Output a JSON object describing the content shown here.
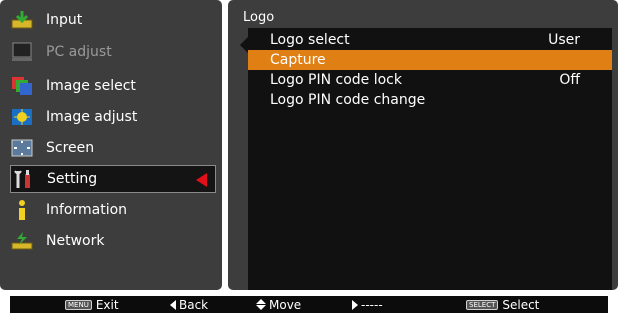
{
  "left_menu": {
    "items": [
      {
        "label": "Input",
        "icon": "input-icon",
        "state": "normal"
      },
      {
        "label": "PC adjust",
        "icon": "pc-adjust-icon",
        "state": "dim"
      },
      {
        "label": "Image select",
        "icon": "image-select-icon",
        "state": "normal"
      },
      {
        "label": "Image adjust",
        "icon": "image-adjust-icon",
        "state": "normal"
      },
      {
        "label": "Screen",
        "icon": "screen-icon",
        "state": "normal"
      },
      {
        "label": "Setting",
        "icon": "setting-icon",
        "state": "selected"
      },
      {
        "label": "Information",
        "icon": "information-icon",
        "state": "normal"
      },
      {
        "label": "Network",
        "icon": "network-icon",
        "state": "normal"
      }
    ]
  },
  "right_panel": {
    "title": "Logo",
    "items": [
      {
        "label": "Logo select",
        "value": "User",
        "highlighted": false
      },
      {
        "label": "Capture",
        "value": "",
        "highlighted": true
      },
      {
        "label": "Logo PIN code lock",
        "value": "Off",
        "highlighted": false
      },
      {
        "label": "Logo PIN code change",
        "value": "",
        "highlighted": false
      }
    ]
  },
  "bottom_bar": {
    "menu_key": "MENU",
    "exit_label": "Exit",
    "back_label": "Back",
    "move_label": "Move",
    "next_label": "-----",
    "select_key": "SELECT",
    "select_label": "Select"
  },
  "colors": {
    "panel_bg": "#3d3d3d",
    "list_bg": "#111111",
    "highlight": "#e07f14",
    "selector_arrow": "#e00f1a"
  }
}
